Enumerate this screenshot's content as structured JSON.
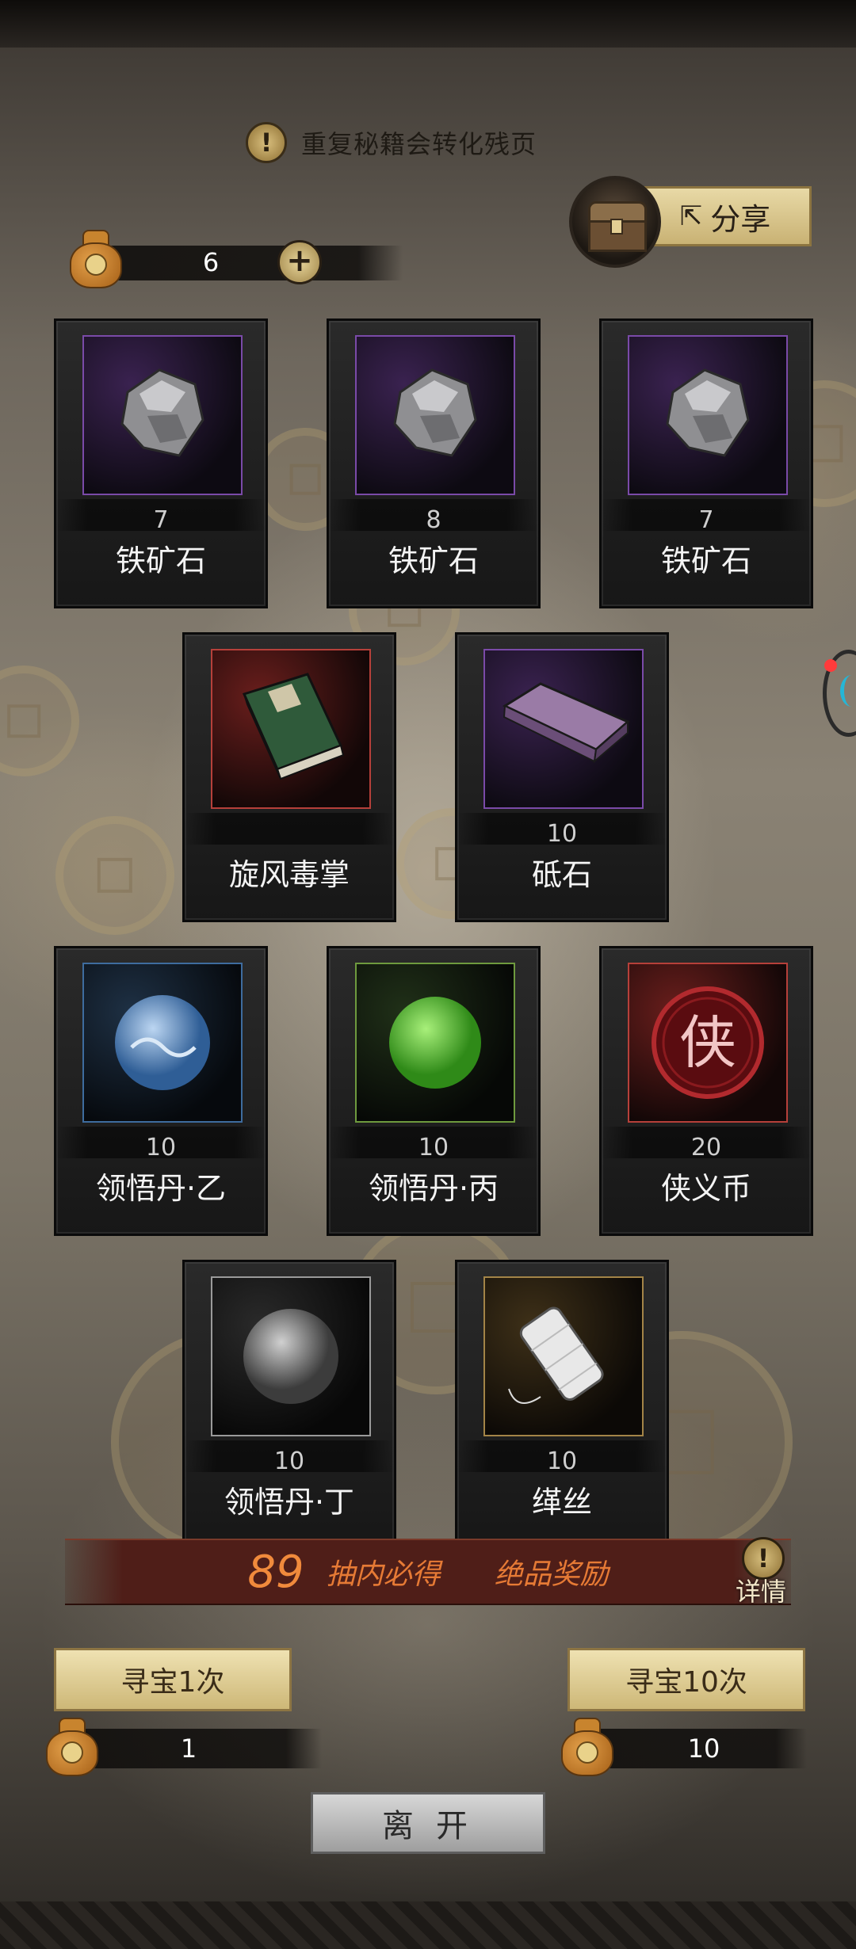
{
  "notice": {
    "text": "重复秘籍会转化残页"
  },
  "share": {
    "label": "分享"
  },
  "currency": {
    "amount": "6"
  },
  "rewards": [
    {
      "count": "7",
      "name": "铁矿石",
      "quality": "purple",
      "icon": "iron-ore-icon"
    },
    {
      "count": "8",
      "name": "铁矿石",
      "quality": "purple",
      "icon": "iron-ore-icon"
    },
    {
      "count": "7",
      "name": "铁矿石",
      "quality": "purple",
      "icon": "iron-ore-icon"
    },
    {
      "count": "",
      "name": "旋风毒掌",
      "quality": "red",
      "icon": "manual-book-icon"
    },
    {
      "count": "10",
      "name": "砥石",
      "quality": "purple",
      "icon": "whetstone-icon"
    },
    {
      "count": "10",
      "name": "领悟丹·乙",
      "quality": "blue",
      "icon": "blue-pill-icon"
    },
    {
      "count": "10",
      "name": "领悟丹·丙",
      "quality": "green",
      "icon": "green-pill-icon"
    },
    {
      "count": "20",
      "name": "侠义币",
      "quality": "red",
      "icon": "chivalry-coin-icon"
    },
    {
      "count": "10",
      "name": "领悟丹·丁",
      "quality": "white",
      "icon": "grey-pill-icon"
    },
    {
      "count": "10",
      "name": "缂丝",
      "quality": "gold",
      "icon": "silk-spool-icon"
    }
  ],
  "banner": {
    "number": "89",
    "text1": "抽内必得",
    "text2": "绝品奖励"
  },
  "detail": {
    "label": "详情"
  },
  "draw_once": {
    "label": "寻宝1次",
    "cost": "1"
  },
  "draw_ten": {
    "label": "寻宝10次",
    "cost": "10"
  },
  "leave": {
    "label": "离开"
  },
  "coin_glyph": "侠",
  "colors": {
    "banner_bg": "#4f1e18",
    "banner_text": "#e67a35",
    "button_gold": "#cdb777"
  }
}
